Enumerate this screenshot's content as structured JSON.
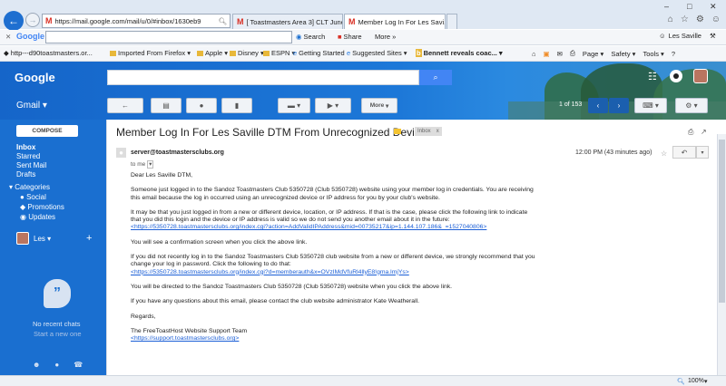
{
  "browser": {
    "address_url": "https://mail.google.com/mail/u/0/#inbox/1630eb9",
    "tabs": [
      {
        "label": "[ Toastmasters Area 3] CLT June..."
      },
      {
        "label": "Member Log In For Les Savi..."
      }
    ],
    "google_toolbar": {
      "brand": "Google",
      "search_label": "Search",
      "share_label": "Share",
      "more_label": "More",
      "user_name": "Les Saville"
    },
    "favorites": [
      {
        "label": "http---d90toastmasters.or..."
      },
      {
        "label": "Imported From Firefox"
      },
      {
        "label": "Apple"
      },
      {
        "label": "Disney"
      },
      {
        "label": "ESPN"
      },
      {
        "label": "Getting Started"
      },
      {
        "label": "Suggested Sites"
      },
      {
        "label": "Bennett reveals coac..."
      }
    ],
    "command_bar": {
      "page_label": "Page",
      "safety_label": "Safety",
      "tools_label": "Tools"
    },
    "zoom": "100%"
  },
  "gmail": {
    "logo": "Google",
    "app_label": "Gmail",
    "compose_label": "COMPOSE",
    "more_label": "More",
    "page_count": "1 of 153",
    "nav": [
      {
        "label": "Inbox"
      },
      {
        "label": "Starred"
      },
      {
        "label": "Sent Mail"
      },
      {
        "label": "Drafts"
      },
      {
        "label": "Categories"
      },
      {
        "label": "Social"
      },
      {
        "label": "Promotions"
      },
      {
        "label": "Updates"
      }
    ],
    "hangouts": {
      "user": "Les",
      "no_chats": "No recent chats",
      "start_new": "Start a new one"
    }
  },
  "email": {
    "subject": "Member Log In For Les Saville DTM From Unrecognized Device",
    "label_chip": "Inbox",
    "label_chip_close": "x",
    "sender": "server@toastmastersclubs.org",
    "to": "to me",
    "time": "12:00 PM (43 minutes ago)",
    "greeting": "Dear Les Saville DTM,",
    "para1": "Someone just logged in to the Sandoz Toastmasters Club 5350728 (Club 5350728) website using your member log in credentials. You are receiving this email because the log in occurred using an unrecognized device or IP address for you by your club's website.",
    "para2": "It may be that you just logged in from a new or different device, location, or IP address.  If that is the case, please click the following link to indicate that you did this login and the device or IP address is valid so we do not send you another email about it in the future:",
    "link1": "<https://5350728.toastmastersclubs.org/index.cgi?action=AddValidIPAddress&mid=00735217&ip=1.144.107.186&_=1527040806>",
    "para3": "You will see a confirmation screen when you click the above link.",
    "para4": "If you did not recently log in to the Sandoz Toastmasters Club 5350728 club website from a new or different device, we strongly recommend that you change your log in password.  Click the following to do that:",
    "link2": "<https://5350728.toastmastersclubs.org/index.cgi?d=memberauth&x=OVzIMdVfuRl4llyE8!gma.lmjYs>",
    "para5": "You will be directed to the Sandoz Toastmasters Club 5350728 (Club 5350728) website when you click the above link.",
    "para6": "If you have any questions about this email, please contact the club website administrator Kate Weatherall.",
    "regards": "Regards,",
    "signature": "The FreeToastHost Website Support Team",
    "link3": "<https://support.toastmastersclubs.org>"
  },
  "icons": [
    "back-arrow-icon",
    "forward-arrow-icon",
    "search-icon",
    "refresh-icon",
    "home-icon",
    "star-icon",
    "gear-icon",
    "apps-grid-icon",
    "reply-icon",
    "archive-icon",
    "spam-icon",
    "trash-icon",
    "folder-icon",
    "label-icon",
    "print-icon",
    "popout-icon",
    "chat-bubble-icon"
  ],
  "colors": {
    "gmail_blue": "#1a6fd0",
    "search_blue": "#4285f4",
    "link": "#1a5ed6",
    "label_yellow": "#f4c430"
  }
}
